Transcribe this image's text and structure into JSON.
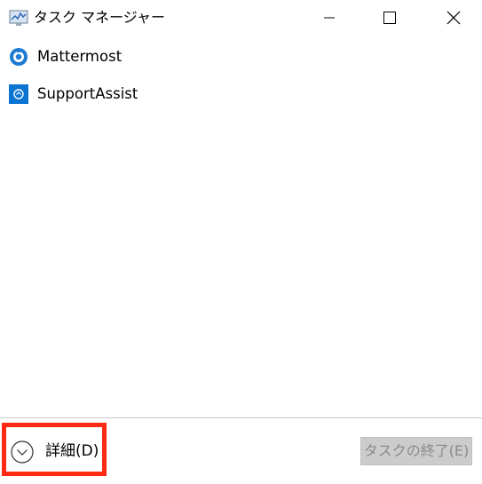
{
  "window": {
    "title": "タスク マネージャー"
  },
  "processes": [
    {
      "name": "Mattermost",
      "icon": "mattermost-icon"
    },
    {
      "name": "SupportAssist",
      "icon": "supportassist-icon"
    }
  ],
  "footer": {
    "details_label": "詳細(D)",
    "end_task_label": "タスクの終了(E)",
    "end_task_enabled": false
  },
  "colors": {
    "highlight_box": "#ff2a14",
    "mattermost_blue": "#1e7bd4",
    "supportassist_blue": "#0a74d0",
    "disabled_button_bg": "#cccccc",
    "disabled_button_text": "#8a8a8a"
  }
}
